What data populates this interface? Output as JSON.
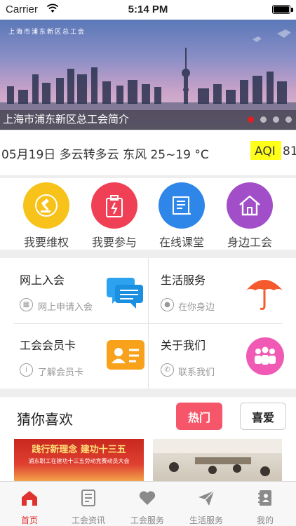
{
  "status_bar": {
    "carrier": "Carrier",
    "time": "5:14 PM"
  },
  "banner": {
    "org_name": "上海市浦东新区总工会",
    "caption": "上海市浦东新区总工会简介",
    "active_slide": 1,
    "slide_count": 4
  },
  "weather": {
    "text": "05月19日  多云转多云  东风  25~19 °C",
    "aqi_label": "AQI",
    "aqi_value": "81"
  },
  "quick_actions": [
    {
      "label": "我要维权",
      "icon": "gavel-icon",
      "color": "#f7c21a"
    },
    {
      "label": "我要参与",
      "icon": "form-icon",
      "color": "#f04055"
    },
    {
      "label": "在线课堂",
      "icon": "document-icon",
      "color": "#2e86e8"
    },
    {
      "label": "身边工会",
      "icon": "house-icon",
      "color": "#a24ec8"
    }
  ],
  "services": [
    {
      "title": "网上入会",
      "sub": "网上申请入会",
      "sub_icon": "grid-icon",
      "art": "chat-bubbles-icon",
      "color": "#2da3f0"
    },
    {
      "title": "生活服务",
      "sub": "在你身边",
      "sub_icon": "location-pin-icon",
      "art": "umbrella-icon",
      "color": "#f55a2c"
    },
    {
      "title": "工会会员卡",
      "sub": "了解会员卡",
      "sub_icon": "info-icon",
      "art": "id-card-icon",
      "color": "#f7a21a"
    },
    {
      "title": "关于我们",
      "sub": "联系我们",
      "sub_icon": "phone-icon",
      "art": "group-icon",
      "color": "#f05ab4"
    }
  ],
  "guess": {
    "title": "猜你喜欢",
    "hot_label": "热门",
    "like_label": "喜爱",
    "thumb1_headline": "践行新理念  建功十三五",
    "thumb1_sub": "浦东职工在建功十三五劳动竞赛动员大会"
  },
  "tabbar": [
    {
      "label": "首页",
      "icon": "home-icon",
      "active": true
    },
    {
      "label": "工会资讯",
      "icon": "news-icon",
      "active": false
    },
    {
      "label": "工会服务",
      "icon": "heart-icon",
      "active": false
    },
    {
      "label": "生活服务",
      "icon": "paper-plane-icon",
      "active": false
    },
    {
      "label": "我的",
      "icon": "contacts-icon",
      "active": false
    }
  ],
  "colors": {
    "accent": "#e0332f",
    "aqi_highlight": "#ffff1a",
    "hot_button": "#f5566a"
  }
}
